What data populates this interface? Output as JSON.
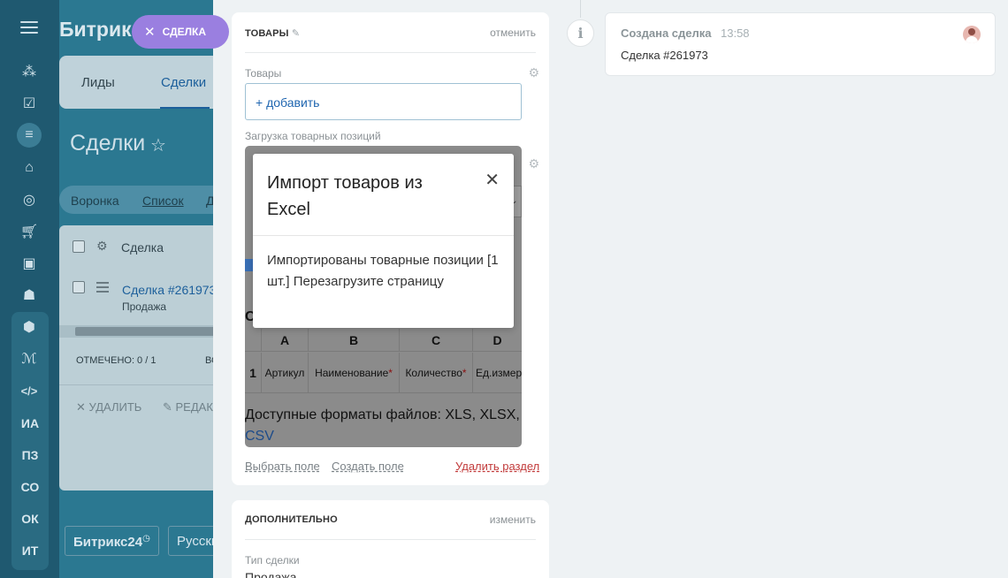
{
  "background": {
    "logo": "Битрик",
    "deal_pill": "СДЕЛКА",
    "tabs": [
      "Лиды",
      "Сделки"
    ],
    "page_title": "Сделки",
    "views": [
      "Воронка",
      "Список",
      "Д"
    ],
    "list": {
      "header": "Сделка",
      "deal_link": "Сделка #261973",
      "deal_stage": "Продажа",
      "marked": "ОТМЕЧЕНО: 0 / 1",
      "marked_extra": "ВС",
      "delete_action": "УДАЛИТЬ",
      "edit_action": "РЕДАК"
    },
    "bottom_buttons": [
      "Битрикс24",
      "Русски"
    ],
    "sidebar_letters": [
      "ИА",
      "ПЗ",
      "СО",
      "ОК",
      "ИТ"
    ]
  },
  "goods_card": {
    "title": "ТОВАРЫ",
    "cancel": "отменить",
    "goods_label": "Товары",
    "add_button": "+ добавить",
    "upload_label": "Загрузка товарных позиций",
    "table_columns": [
      "A",
      "B",
      "C",
      "D"
    ],
    "table_row": {
      "num": "1",
      "cells": [
        "Артикул",
        "Наименование",
        "Количество",
        "Ед.измер"
      ],
      "required_mark": "*"
    },
    "hidden_heading": "С",
    "formats_text": "Доступные форматы файлов: XLS, XLSX,",
    "formats_csv": "CSV",
    "footer": {
      "select_field": "Выбрать поле",
      "create_field": "Создать поле",
      "delete_section": "Удалить раздел"
    }
  },
  "extra_card": {
    "title": "ДОПОЛНИТЕЛЬНО",
    "change": "изменить",
    "deal_type_label": "Тип сделки",
    "deal_type_value": "Продажа"
  },
  "modal": {
    "title": "Импорт товаров из Excel",
    "body": "Импортированы товарные позиции [1 шт.] Перезагрузите страницу",
    "close_symbol": "✕"
  },
  "timeline": {
    "info_symbol": "i",
    "event_title": "Создана сделка",
    "event_time": "13:58",
    "event_body": "Сделка #261973"
  },
  "colors": {
    "sidebar": "#1f5970",
    "crm_bg": "#2b7891",
    "deal_pill": "#9a7fe0",
    "link_blue": "#2066b0",
    "delete_red": "#c23b3b"
  }
}
